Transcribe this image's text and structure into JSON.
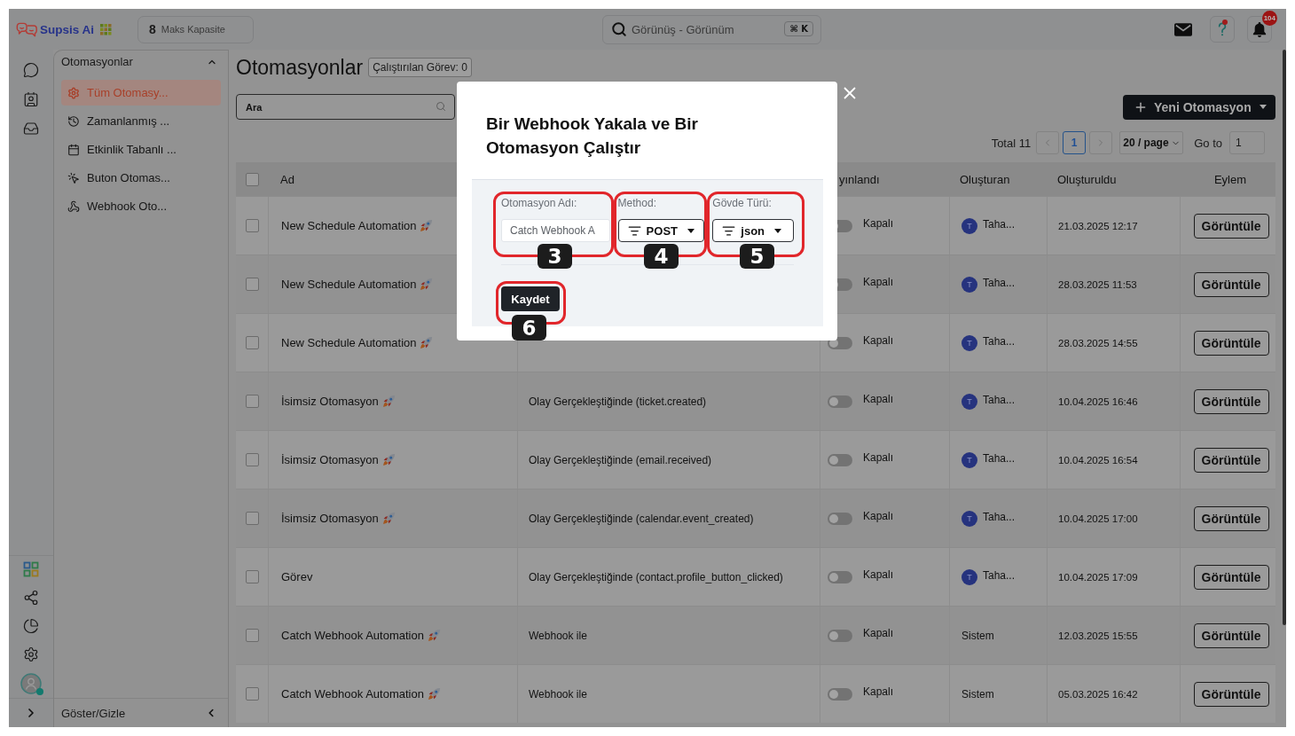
{
  "header": {
    "logo": "Supsis Ai",
    "capacity": {
      "count": "8",
      "label": "Maks Kapasite"
    },
    "search": {
      "placeholder": "Görünüş - Görünüm",
      "shortcut": "⌘ K"
    },
    "notifications": {
      "count": "104"
    }
  },
  "sidebar": {
    "title": "Otomasyonlar",
    "expanded": true,
    "items": [
      {
        "label": "Tüm Otomasy...",
        "selected": true
      },
      {
        "label": "Zamanlanmış ...",
        "selected": false
      },
      {
        "label": "Etkinlik Tabanlı ...",
        "selected": false
      },
      {
        "label": "Buton Otomas...",
        "selected": false
      },
      {
        "label": "Webhook Oto...",
        "selected": false
      }
    ],
    "footer": "Göster/Gizle"
  },
  "page": {
    "title": "Otomasyonlar",
    "badge": "Çalıştırılan Görev: 0",
    "search": {
      "placeholder": "Ara"
    },
    "new_button": "Yeni Otomasyon"
  },
  "pagination": {
    "total": "Total 11",
    "pages": [
      {
        "label": "1",
        "selected": true
      }
    ],
    "page_size": "20 / page",
    "goto_label": "Go to",
    "goto_value": "1"
  },
  "table": {
    "all_checked": false,
    "columns": {
      "name": "Ad",
      "published": "yınlandı",
      "creator": "Oluşturan",
      "created": "Oluşturuldu",
      "action": "Eylem"
    },
    "rows": [
      {
        "checked": false,
        "name": "New Schedule Automation",
        "rocket": true,
        "published": false,
        "status": "Kapalı",
        "creator": {
          "avatar": "T",
          "name": "Taha..."
        },
        "created": "21.03.2025 12:17",
        "action": "Görüntüle"
      },
      {
        "checked": false,
        "name": "New Schedule Automation",
        "rocket": true,
        "published": false,
        "status": "Kapalı",
        "creator": {
          "avatar": "T",
          "name": "Taha..."
        },
        "created": "28.03.2025 11:53",
        "action": "Görüntüle"
      },
      {
        "checked": false,
        "name": "New Schedule Automation",
        "rocket": true,
        "published": false,
        "status": "Kapalı",
        "creator": {
          "avatar": "T",
          "name": "Taha..."
        },
        "created": "28.03.2025 14:55",
        "action": "Görüntüle"
      },
      {
        "checked": false,
        "name": "İsimsiz Otomasyon",
        "rocket": true,
        "trigger": "Olay Gerçekleştiğinde (ticket.created)",
        "published": false,
        "status": "Kapalı",
        "creator": {
          "avatar": "T",
          "name": "Taha..."
        },
        "created": "10.04.2025 16:46",
        "action": "Görüntüle"
      },
      {
        "checked": false,
        "name": "İsimsiz Otomasyon",
        "rocket": true,
        "trigger": "Olay Gerçekleştiğinde (email.received)",
        "published": false,
        "status": "Kapalı",
        "creator": {
          "avatar": "T",
          "name": "Taha..."
        },
        "created": "10.04.2025 16:54",
        "action": "Görüntüle"
      },
      {
        "checked": false,
        "name": "İsimsiz Otomasyon",
        "rocket": true,
        "trigger": "Olay Gerçekleştiğinde (calendar.event_created)",
        "published": false,
        "status": "Kapalı",
        "creator": {
          "avatar": "T",
          "name": "Taha..."
        },
        "created": "10.04.2025 17:00",
        "action": "Görüntüle"
      },
      {
        "checked": false,
        "name": "Görev",
        "rocket": false,
        "trigger": "Olay Gerçekleştiğinde (contact.profile_button_clicked)",
        "published": false,
        "status": "Kapalı",
        "creator": {
          "avatar": "T",
          "name": "Taha..."
        },
        "created": "10.04.2025 17:09",
        "action": "Görüntüle"
      },
      {
        "checked": false,
        "name": "Catch Webhook Automation",
        "rocket": true,
        "trigger": "Webhook ile",
        "published": false,
        "status": "Kapalı",
        "creator": {
          "name": "Sistem"
        },
        "created": "12.03.2025 15:55",
        "action": "Görüntüle"
      },
      {
        "checked": false,
        "name": "Catch Webhook Automation",
        "rocket": true,
        "trigger": "Webhook ile",
        "published": false,
        "status": "Kapalı",
        "creator": {
          "name": "Sistem"
        },
        "created": "05.03.2025 16:42",
        "action": "Görüntüle"
      }
    ]
  },
  "modal": {
    "title": "Bir Webhook Yakala ve Bir Otomasyon Çalıştır",
    "fields": [
      {
        "kind": "input",
        "label": "Otomasyon Adı:",
        "value": "Catch Webhook A",
        "marker": "3"
      },
      {
        "kind": "dropdown",
        "label": "Method:",
        "value": "POST",
        "marker": "4"
      },
      {
        "kind": "dropdown",
        "label": "Gövde Türü:",
        "value": "json",
        "marker": "5"
      }
    ],
    "save": {
      "label": "Kaydet",
      "marker": "6"
    }
  }
}
